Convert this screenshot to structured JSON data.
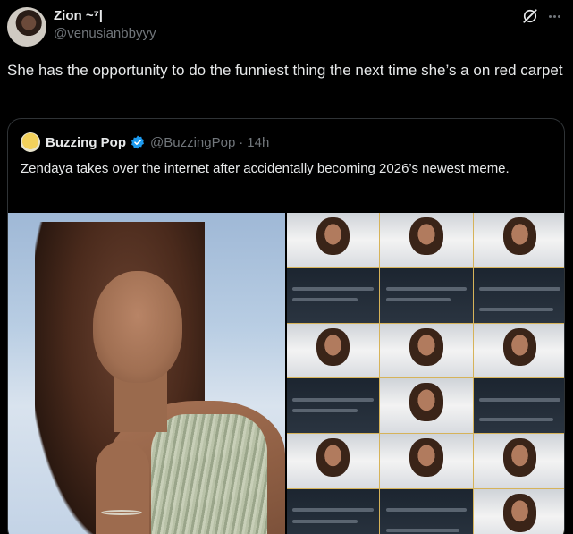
{
  "tweet": {
    "author_name": "Zion ~⁷|",
    "author_handle": "@venusianbbyyy",
    "text": "She has the opportunity to do the funniest thing the next time she’s a on red carpet"
  },
  "quoted": {
    "name": "Buzzing Pop",
    "handle": "@BuzzingPop",
    "separator": "·",
    "time": "14h",
    "text": "Zendaya takes over the internet after accidentally becoming 2026’s newest meme.",
    "verified": true
  },
  "colors": {
    "background": "#000000",
    "text_primary": "#e7e9ea",
    "text_secondary": "#71767b",
    "verified_badge": "#1d9bf0",
    "border": "#2f3336"
  },
  "icons": [
    "grok-icon",
    "more-icon",
    "verified-badge-icon"
  ]
}
